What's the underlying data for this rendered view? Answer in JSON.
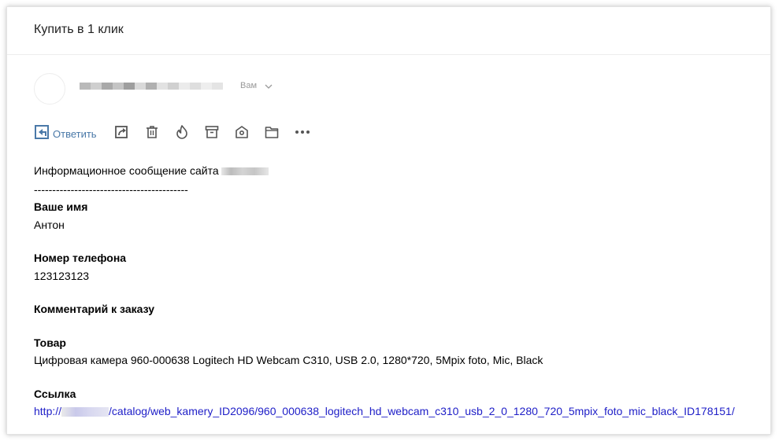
{
  "window": {
    "subject": "Купить в 1 клик"
  },
  "sender": {
    "to_label": "Вам"
  },
  "toolbar": {
    "reply_label": "Ответить",
    "icons": [
      "reply-icon",
      "forward-icon",
      "delete-icon",
      "spam-icon",
      "archive-icon",
      "move-icon",
      "folder-icon",
      "more-icon"
    ]
  },
  "message": {
    "intro": "Информационное сообщение сайта",
    "separator": "------------------------------------------",
    "fields": [
      {
        "label": "Ваше имя",
        "value": "Антон"
      },
      {
        "label": "Номер телефона",
        "value": "123123123"
      },
      {
        "label": "Комментарий к заказу",
        "value": ""
      },
      {
        "label": "Товар",
        "value": "Цифровая камера 960-000638 Logitech HD Webcam C310, USB 2.0, 1280*720, 5Mpix foto, Mic, Black"
      },
      {
        "label": "Ссылка",
        "value": ""
      }
    ],
    "link_prefix": "http://",
    "link_path": "/catalog/web_kamery_ID2096/960_000638_logitech_hd_webcam_c310_usb_2_0_1280_720_5mpix_foto_mic_black_ID178151/"
  },
  "colors": {
    "link": "#2020c8",
    "reply": "#4a79a8",
    "icon": "#555555"
  }
}
